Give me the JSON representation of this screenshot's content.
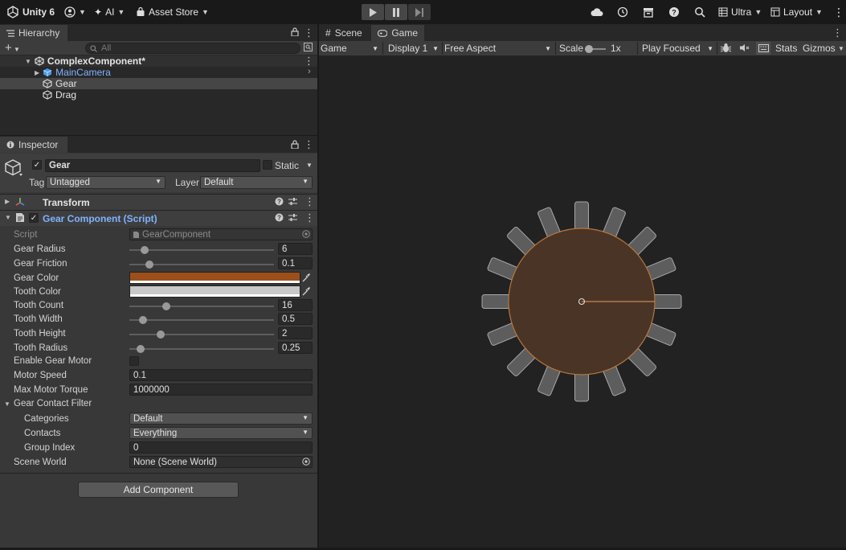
{
  "toolbar": {
    "app_name": "Unity 6",
    "ai_label": "AI",
    "asset_store_label": "Asset Store",
    "ultra_label": "Ultra",
    "layout_label": "Layout"
  },
  "hierarchy": {
    "tab_label": "Hierarchy",
    "search_placeholder": "All",
    "root": "ComplexComponent*",
    "items": [
      "MainCamera",
      "Gear",
      "Drag"
    ]
  },
  "game_view": {
    "tabs": [
      "Scene",
      "Game"
    ],
    "mode": "Game",
    "display": "Display 1",
    "aspect": "Free Aspect",
    "scale_label": "Scale",
    "scale_value": "1x",
    "play_mode": "Play Focused",
    "stats_label": "Stats",
    "gizmos_label": "Gizmos"
  },
  "inspector": {
    "tab_label": "Inspector",
    "object_name": "Gear",
    "static_label": "Static",
    "tag_label": "Tag",
    "tag_value": "Untagged",
    "layer_label": "Layer",
    "layer_value": "Default",
    "transform_label": "Transform",
    "component_label": "Gear Component (Script)",
    "script_label": "Script",
    "script_value": "GearComponent",
    "gear_radius_label": "Gear Radius",
    "gear_radius_value": "6",
    "gear_radius_fraction": 0.08,
    "gear_friction_label": "Gear Friction",
    "gear_friction_value": "0.1",
    "gear_friction_fraction": 0.12,
    "gear_color_label": "Gear Color",
    "gear_color": "#9c4f1b",
    "tooth_color_label": "Tooth Color",
    "tooth_color": "#c8c8c8",
    "tooth_count_label": "Tooth Count",
    "tooth_count_value": "16",
    "tooth_count_fraction": 0.24,
    "tooth_width_label": "Tooth Width",
    "tooth_width_value": "0.5",
    "tooth_width_fraction": 0.07,
    "tooth_height_label": "Tooth Height",
    "tooth_height_value": "2",
    "tooth_height_fraction": 0.2,
    "tooth_radius_label": "Tooth Radius",
    "tooth_radius_value": "0.25",
    "tooth_radius_fraction": 0.05,
    "enable_motor_label": "Enable Gear Motor",
    "motor_speed_label": "Motor Speed",
    "motor_speed_value": "0.1",
    "max_torque_label": "Max Motor Torque",
    "max_torque_value": "1000000",
    "filter_label": "Gear Contact Filter",
    "categories_label": "Categories",
    "categories_value": "Default",
    "contacts_label": "Contacts",
    "contacts_value": "Everything",
    "group_index_label": "Group Index",
    "group_index_value": "0",
    "scene_world_label": "Scene World",
    "scene_world_value": "None (Scene World)",
    "add_component_label": "Add Component"
  },
  "colors": {
    "accent_blue": "#7fb3ff",
    "gear_fill": "#4a3426",
    "gear_outline": "#b3773f"
  }
}
